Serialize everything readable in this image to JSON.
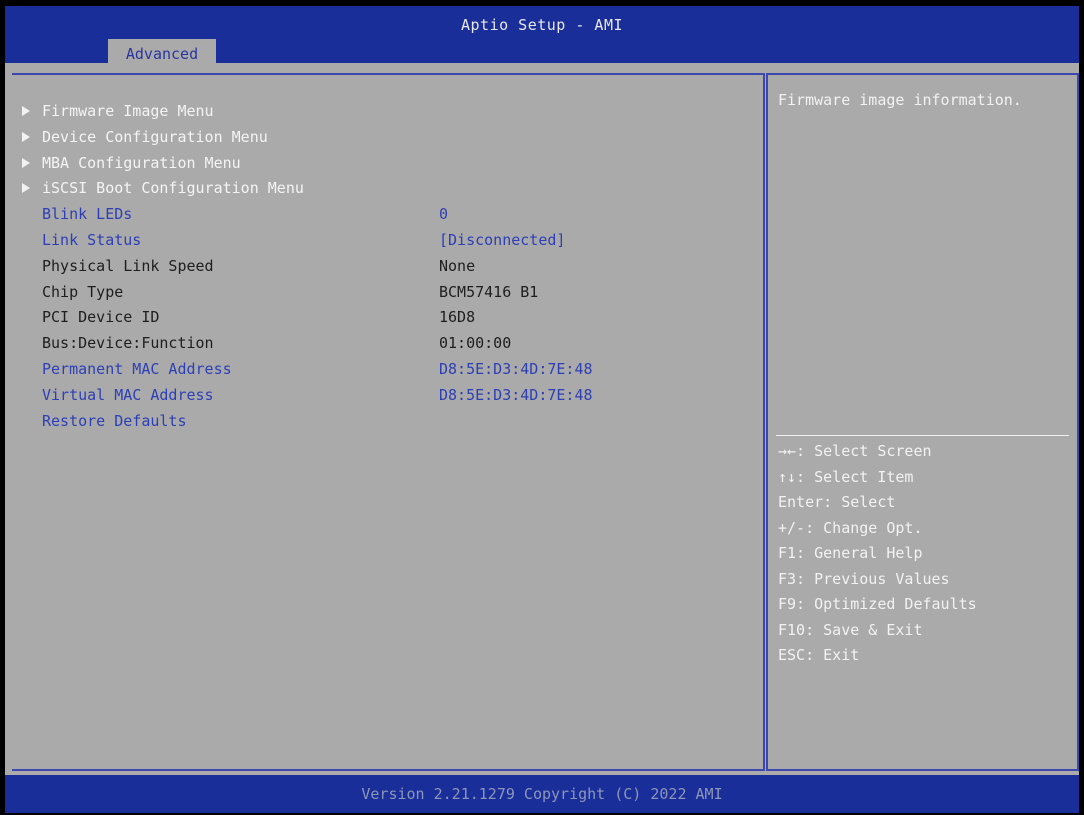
{
  "header": {
    "title": "Aptio Setup - AMI",
    "tab": "Advanced"
  },
  "menu": [
    {
      "label": "Firmware Image Menu",
      "value": "",
      "submenu": true,
      "style": "white"
    },
    {
      "label": "Device Configuration Menu",
      "value": "",
      "submenu": true,
      "style": "white"
    },
    {
      "label": "MBA Configuration Menu",
      "value": "",
      "submenu": true,
      "style": "white"
    },
    {
      "label": "iSCSI Boot Configuration Menu",
      "value": "",
      "submenu": true,
      "style": "white"
    },
    {
      "label": "Blink LEDs",
      "value": "0",
      "submenu": false,
      "style": "blue"
    },
    {
      "label": "Link Status",
      "value": "[Disconnected]",
      "submenu": false,
      "style": "blue"
    },
    {
      "label": "Physical Link Speed",
      "value": "None",
      "submenu": false,
      "style": "dark"
    },
    {
      "label": "Chip Type",
      "value": "BCM57416 B1",
      "submenu": false,
      "style": "dark"
    },
    {
      "label": "PCI Device ID",
      "value": "16D8",
      "submenu": false,
      "style": "dark"
    },
    {
      "label": "Bus:Device:Function",
      "value": "01:00:00",
      "submenu": false,
      "style": "dark"
    },
    {
      "label": "Permanent MAC Address",
      "value": "D8:5E:D3:4D:7E:48",
      "submenu": false,
      "style": "blue"
    },
    {
      "label": "Virtual MAC Address",
      "value": "D8:5E:D3:4D:7E:48",
      "submenu": false,
      "style": "blue"
    },
    {
      "label": "Restore Defaults",
      "value": "",
      "submenu": false,
      "style": "blue"
    }
  ],
  "help": {
    "text": "Firmware image information.",
    "keys": [
      "→←: Select Screen",
      "↑↓: Select Item",
      "Enter: Select",
      "+/-: Change Opt.",
      "F1: General Help",
      "F3: Previous Values",
      "F9: Optimized Defaults",
      "F10: Save & Exit",
      "ESC: Exit"
    ]
  },
  "footer": {
    "text": "Version 2.21.1279 Copyright (C) 2022 AMI"
  },
  "colors": {
    "header_bg": "#1a2e9a",
    "panel_bg": "#aaaaaa",
    "accent_blue": "#2d3fb5",
    "highlight": "#f4f4f4"
  }
}
